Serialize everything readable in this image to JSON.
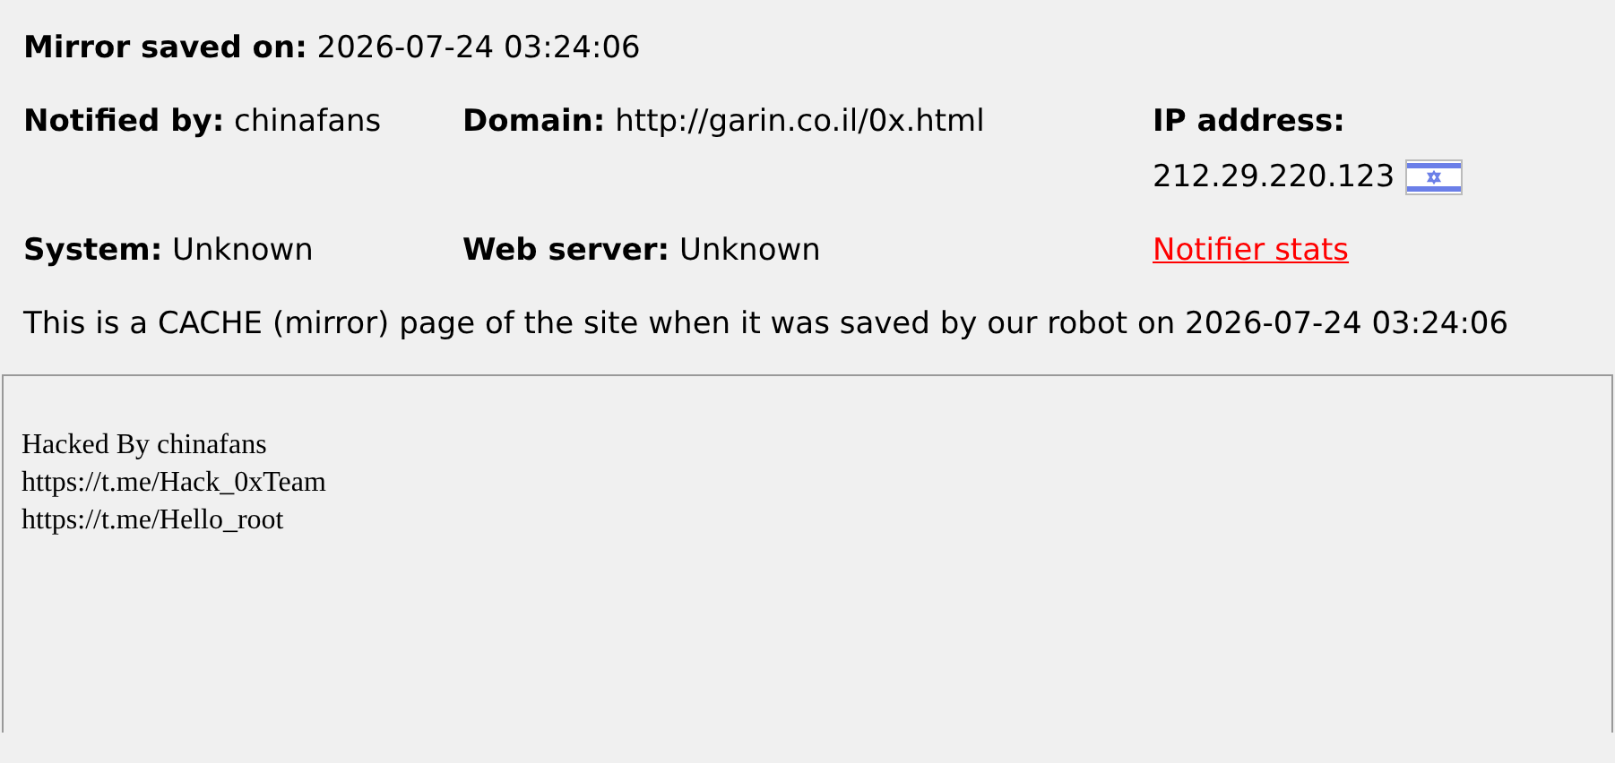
{
  "saved": {
    "label": "Mirror saved on:",
    "value": "2026-07-24 03:24:06"
  },
  "fields": [
    {
      "kind": "field",
      "label": "Notified by:",
      "value": "chinafans"
    },
    {
      "kind": "field",
      "label": "Domain:",
      "value": "http://garin.co.il/0x.html"
    },
    {
      "kind": "ip",
      "label": "IP address:",
      "value": "212.29.220.123"
    },
    {
      "kind": "field",
      "label": "System:",
      "value": "Unknown"
    },
    {
      "kind": "field",
      "label": "Web server:",
      "value": "Unknown"
    },
    {
      "kind": "link",
      "value": "Notifier stats"
    }
  ],
  "notice": "This is a CACHE (mirror) page of the site when it was saved by our robot on 2026-07-24 03:24:06",
  "mirror_lines": [
    "Hacked By chinafans",
    "https://t.me/Hack_0xTeam",
    "https://t.me/Hello_root"
  ]
}
